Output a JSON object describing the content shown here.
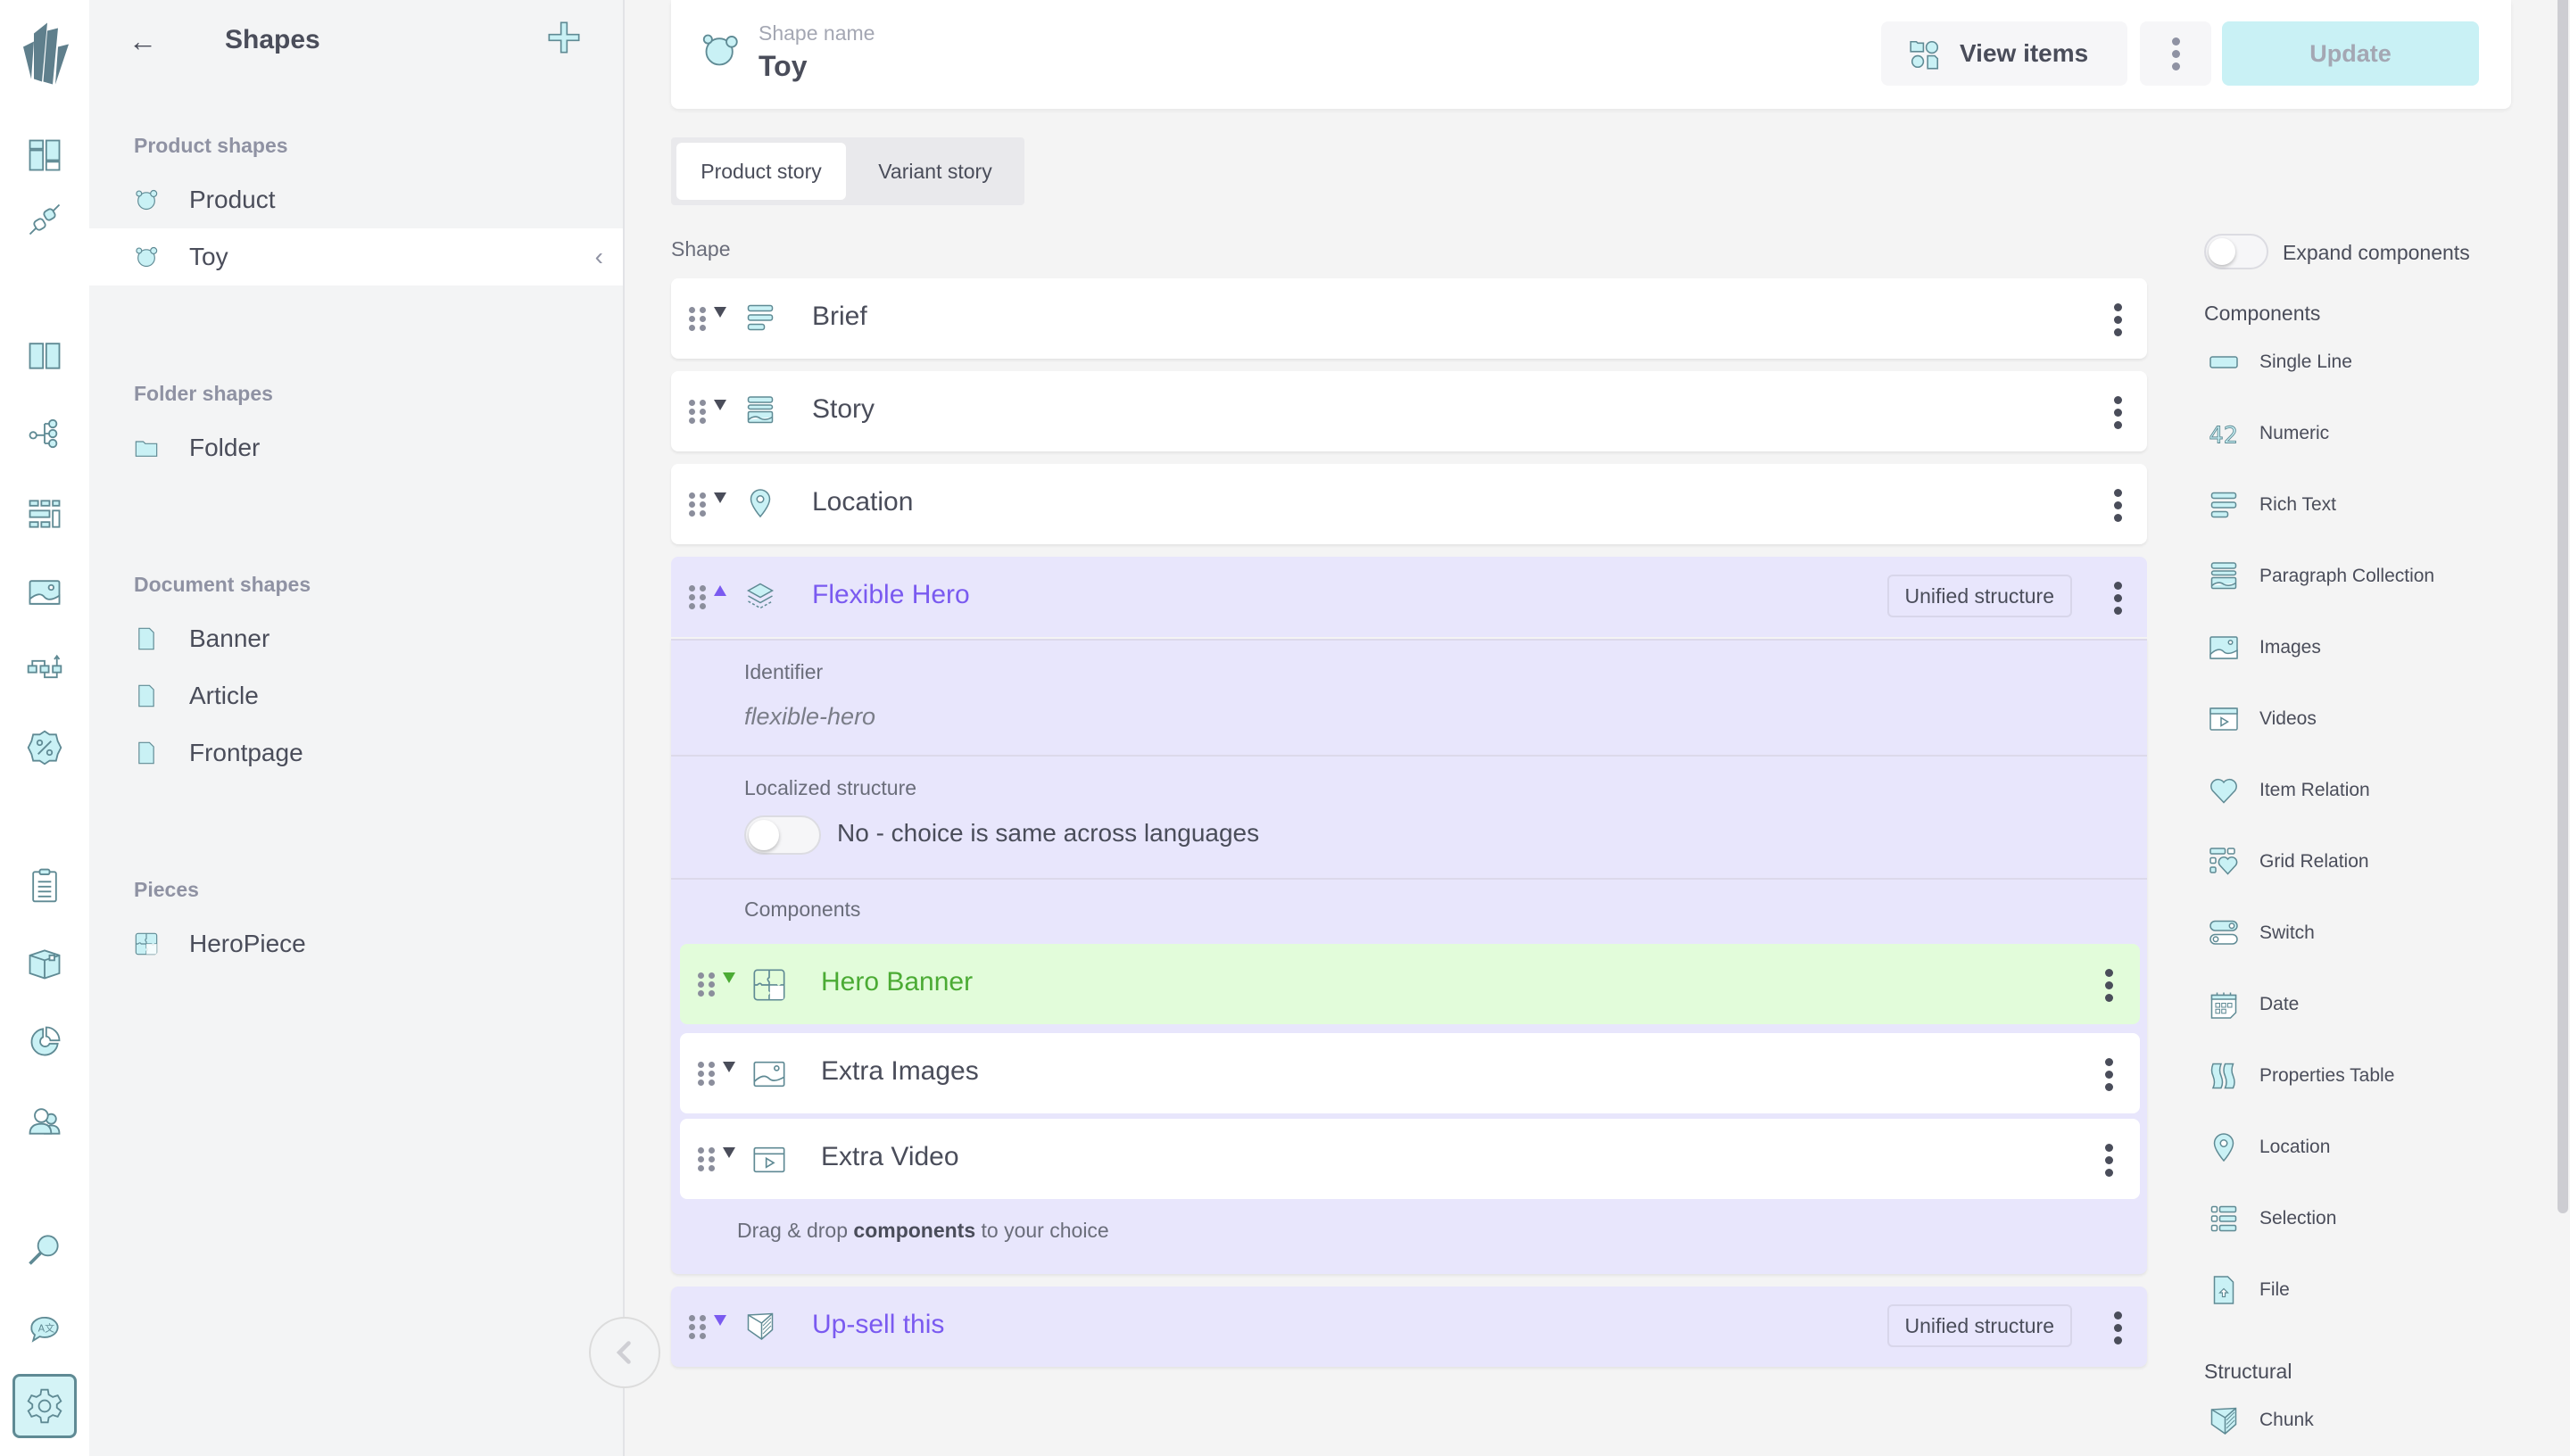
{
  "colors": {
    "accent_cyan": "#c9f1f5",
    "icon_stroke": "#5f8a94",
    "chunk_purple": "#7a5af0",
    "chunk_bg": "#e8e6fc",
    "piece_green": "#4bab34",
    "piece_bg": "#e2fcda"
  },
  "rail": {
    "items": [
      {
        "name": "logo-icon"
      },
      {
        "name": "dashboard-icon"
      },
      {
        "name": "plugins-icon"
      },
      {
        "name": "catalogue-icon"
      },
      {
        "name": "topics-icon"
      },
      {
        "name": "grids-icon"
      },
      {
        "name": "media-icon"
      },
      {
        "name": "flows-icon"
      },
      {
        "name": "discounts-icon"
      },
      {
        "name": "orders-icon"
      },
      {
        "name": "fulfilment-icon"
      },
      {
        "name": "reports-icon"
      },
      {
        "name": "customers-icon"
      },
      {
        "name": "search-icon"
      },
      {
        "name": "translate-icon"
      },
      {
        "name": "settings-icon",
        "active": true
      }
    ]
  },
  "sidebar": {
    "title": "Shapes",
    "back_icon": "arrow-left-icon",
    "add_icon": "plus-icon",
    "sections": [
      {
        "title": "Product shapes",
        "items": [
          {
            "label": "Product",
            "icon": "bear-icon"
          },
          {
            "label": "Toy",
            "icon": "bear-icon",
            "selected": true
          }
        ]
      },
      {
        "title": "Folder shapes",
        "items": [
          {
            "label": "Folder",
            "icon": "folder-icon"
          }
        ]
      },
      {
        "title": "Document shapes",
        "items": [
          {
            "label": "Banner",
            "icon": "document-icon"
          },
          {
            "label": "Article",
            "icon": "document-icon"
          },
          {
            "label": "Frontpage",
            "icon": "document-icon"
          }
        ]
      },
      {
        "title": "Pieces",
        "items": [
          {
            "label": "HeroPiece",
            "icon": "puzzle-icon"
          }
        ]
      }
    ]
  },
  "header": {
    "shape_name_label": "Shape name",
    "shape_name_value": "Toy",
    "view_items_label": "View items",
    "update_label": "Update"
  },
  "tabs": [
    {
      "label": "Product story",
      "active": true
    },
    {
      "label": "Variant story",
      "active": false
    }
  ],
  "shape_section_label": "Shape",
  "shape_components": [
    {
      "name": "Brief",
      "type": "rich-text"
    },
    {
      "name": "Story",
      "type": "paragraph-collection"
    },
    {
      "name": "Location",
      "type": "location"
    }
  ],
  "flexible_hero": {
    "name": "Flexible Hero",
    "badge": "Unified structure",
    "expanded": true,
    "identifier_label": "Identifier",
    "identifier_value": "flexible-hero",
    "localized_label": "Localized structure",
    "localized_toggle_text": "No - choice is same across languages",
    "localized_on": false,
    "components_label": "Components",
    "components": [
      {
        "name": "Hero Banner",
        "type": "piece"
      },
      {
        "name": "Extra Images",
        "type": "images"
      },
      {
        "name": "Extra Video",
        "type": "videos"
      }
    ],
    "dnd_prefix": "Drag & drop ",
    "dnd_bold": "components",
    "dnd_suffix": " to your choice"
  },
  "upsell": {
    "name": "Up-sell this",
    "badge": "Unified structure"
  },
  "right_panel": {
    "expand_label": "Expand components",
    "expand_on": false,
    "components_heading": "Components",
    "components": [
      {
        "label": "Single Line",
        "icon": "single-line-icon"
      },
      {
        "label": "Numeric",
        "icon": "numeric-icon"
      },
      {
        "label": "Rich Text",
        "icon": "rich-text-icon"
      },
      {
        "label": "Paragraph Collection",
        "icon": "paragraph-collection-icon"
      },
      {
        "label": "Images",
        "icon": "images-icon"
      },
      {
        "label": "Videos",
        "icon": "videos-icon"
      },
      {
        "label": "Item Relation",
        "icon": "item-relation-icon"
      },
      {
        "label": "Grid Relation",
        "icon": "grid-relation-icon"
      },
      {
        "label": "Switch",
        "icon": "switch-icon"
      },
      {
        "label": "Date",
        "icon": "date-icon"
      },
      {
        "label": "Properties Table",
        "icon": "properties-table-icon"
      },
      {
        "label": "Location",
        "icon": "location-icon"
      },
      {
        "label": "Selection",
        "icon": "selection-icon"
      },
      {
        "label": "File",
        "icon": "file-icon"
      }
    ],
    "structural_heading": "Structural",
    "structural": [
      {
        "label": "Chunk",
        "icon": "chunk-icon"
      }
    ]
  }
}
